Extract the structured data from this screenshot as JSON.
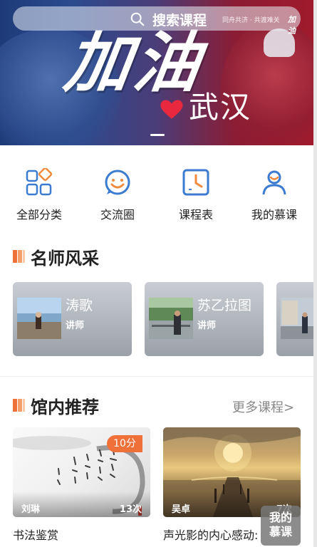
{
  "banner": {
    "title": "加油",
    "subtitle": "武汉",
    "slogan": "同舟共济 · 共渡难关",
    "slogan_mark": "加油"
  },
  "search": {
    "label": "搜索课程"
  },
  "nav": [
    {
      "label": "全部分类",
      "icon": "grid-icon"
    },
    {
      "label": "交流圈",
      "icon": "smile-chat-icon"
    },
    {
      "label": "课程表",
      "icon": "clock-icon"
    },
    {
      "label": "我的慕课",
      "icon": "user-icon"
    }
  ],
  "teachers_section": {
    "title": "名师风采"
  },
  "teachers": [
    {
      "name": "涛歌",
      "role": "讲师"
    },
    {
      "name": "苏乙拉图",
      "role": "讲师"
    },
    {
      "name": "",
      "role": ""
    }
  ],
  "courses_section": {
    "title": "馆内推荐",
    "more": "更多课程>"
  },
  "courses": [
    {
      "title": "书法鉴赏",
      "teacher": "刘琳",
      "views": "13次",
      "score": "10分"
    },
    {
      "title": "声光影的内心感动:",
      "teacher": "吴卓",
      "views": "7次"
    }
  ],
  "float_button": {
    "label": "我的慕课"
  },
  "colors": {
    "accent": "#f0703a",
    "bar_light": "#f5a06c",
    "nav_blue": "#3b7bd0",
    "nav_orange": "#f08a3c"
  }
}
